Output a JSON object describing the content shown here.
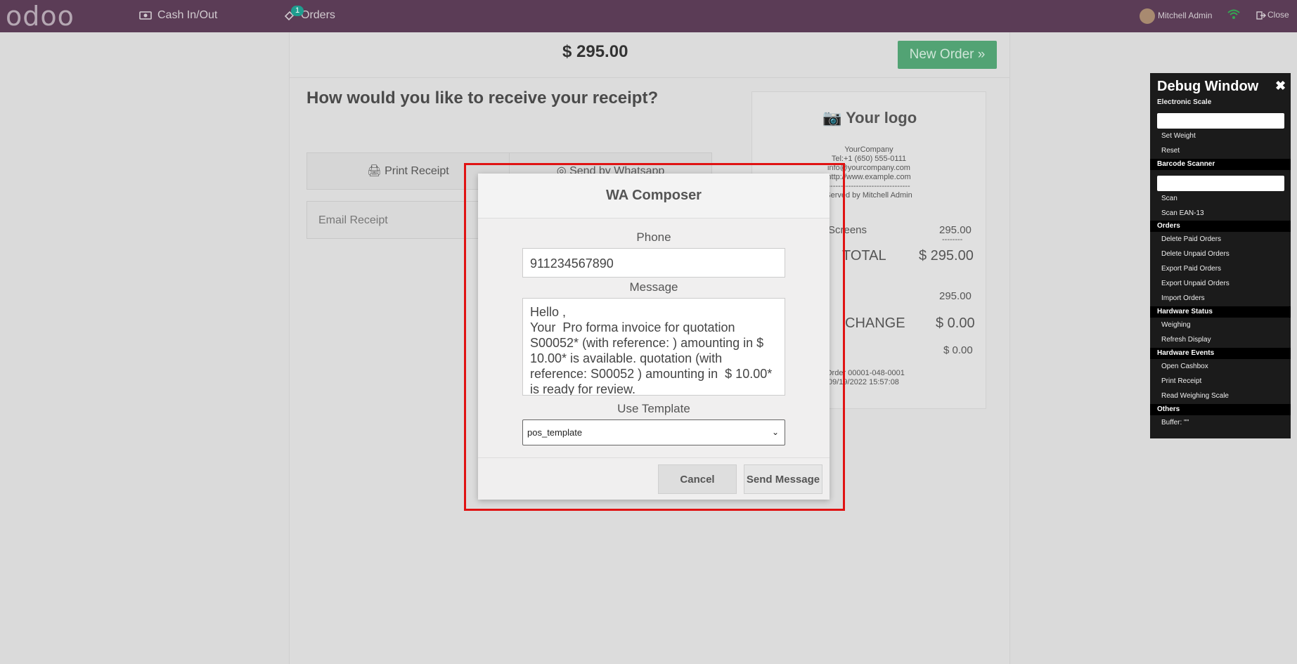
{
  "navbar": {
    "logo": "odoo",
    "cash_label": "Cash In/Out",
    "orders_label": "Orders",
    "orders_badge": "1",
    "user_name": "Mitchell Admin",
    "close_label": "Close"
  },
  "pos": {
    "total_amount": "$ 295.00",
    "new_order_label": "New Order »",
    "receipt_question": "How would you like to receive your receipt?",
    "print_receipt_label": "Print Receipt",
    "whatsapp_label": "Send by Whatsapp",
    "email_placeholder": "Email Receipt"
  },
  "ticket": {
    "logo_text": "Your logo",
    "company": "YourCompany",
    "tel": "Tel:+1 (650) 555-0111",
    "email": "info@yourcompany.com",
    "website": "http://www.example.com",
    "separator": "--------------------------------",
    "served_by": "Served by Mitchell Admin",
    "product": "Screens",
    "product_price": "295.00",
    "dashes": "--------",
    "total_label": "TOTAL",
    "total_value": "$ 295.00",
    "paid_value": "295.00",
    "change_label": "CHANGE",
    "change_value": "$ 0.00",
    "tax_value": "$ 0.00",
    "order_ref": "Order 00001-048-0001",
    "order_date": "09/19/2022 15:57:08"
  },
  "modal": {
    "title": "WA Composer",
    "phone_label": "Phone",
    "phone_value": "911234567890",
    "message_label": "Message",
    "message_value": "Hello ,\nYour  Pro forma invoice for quotation S00052* (with reference: ) amounting in $ 10.00* is available. quotation (with reference: S00052 ) amounting in  $ 10.00* is ready for review.",
    "template_label": "Use Template",
    "template_value": "pos_template",
    "cancel_label": "Cancel",
    "send_label": "Send Message"
  },
  "debug": {
    "title": "Debug Window",
    "close": "✖",
    "sections": {
      "scale": "Electronic Scale",
      "barcode": "Barcode Scanner",
      "orders": "Orders",
      "hardware_status": "Hardware Status",
      "hardware_events": "Hardware Events",
      "others": "Others"
    },
    "items": {
      "set_weight": "Set Weight",
      "reset": "Reset",
      "scan": "Scan",
      "scan_ean": "Scan EAN-13",
      "delete_paid": "Delete Paid Orders",
      "delete_unpaid": "Delete Unpaid Orders",
      "export_paid": "Export Paid Orders",
      "export_unpaid": "Export Unpaid Orders",
      "import_orders": "Import Orders",
      "weighing": "Weighing",
      "refresh_display": "Refresh Display",
      "open_cashbox": "Open Cashbox",
      "print_receipt": "Print Receipt",
      "read_scale": "Read Weighing Scale",
      "buffer": "Buffer: \"\""
    }
  },
  "colors": {
    "navbar": "#5b3c56",
    "new_order": "#52a374",
    "highlight_frame": "#e01313",
    "badge": "#1f9d8f"
  }
}
